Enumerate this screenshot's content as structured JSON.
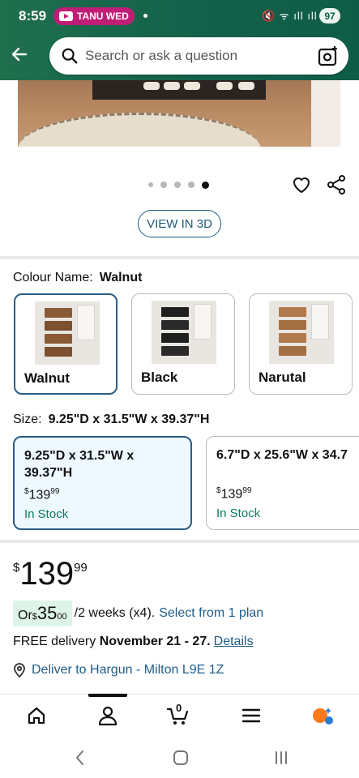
{
  "status_bar": {
    "time": "8:59",
    "notification_label": "TANU WED",
    "system_icons": "🔇 ᯤ ıll ıll",
    "battery": "97"
  },
  "header": {
    "search_placeholder": "Search or ask a question"
  },
  "gallery": {
    "dot_count": 5,
    "active_dot": 5,
    "view_3d_label": "VIEW IN 3D"
  },
  "colour": {
    "label": "Colour Name:",
    "selected": "Walnut",
    "options": [
      {
        "name": "Walnut",
        "selected": true
      },
      {
        "name": "Black",
        "selected": false
      },
      {
        "name": "Narutal",
        "selected": false
      }
    ]
  },
  "size": {
    "label": "Size:",
    "selected": "9.25\"D x 31.5\"W x 39.37\"H",
    "options": [
      {
        "dimensions": "9.25\"D x 31.5\"W x\n39.37\"H",
        "price": "139",
        "price_cents": "99",
        "stock": "In Stock",
        "selected": true
      },
      {
        "dimensions": "6.7\"D x 25.6\"W x 34.7",
        "price": "139",
        "price_cents": "99",
        "stock": "In Stock",
        "selected": false
      }
    ]
  },
  "price": {
    "currency": "$",
    "whole": "139",
    "cents": "99"
  },
  "installment": {
    "prefix": "Or ",
    "currency": "$",
    "amount": "35",
    "cents": "00",
    "terms": "/2 weeks (x4).",
    "link": "Select from 1 plan"
  },
  "delivery": {
    "prefix": "FREE delivery",
    "dates": "November 21 - 27.",
    "details_link": "Details"
  },
  "deliver_to": "Deliver to Hargun - Milton L9E 1Z",
  "bottom_nav": {
    "cart_count": "0"
  },
  "colors": {
    "header_green": "#13614a",
    "link_blue": "#1f5c86",
    "selected_border": "#2c5d84",
    "in_stock_green": "#067d62",
    "installment_bg": "#dff4e8"
  }
}
